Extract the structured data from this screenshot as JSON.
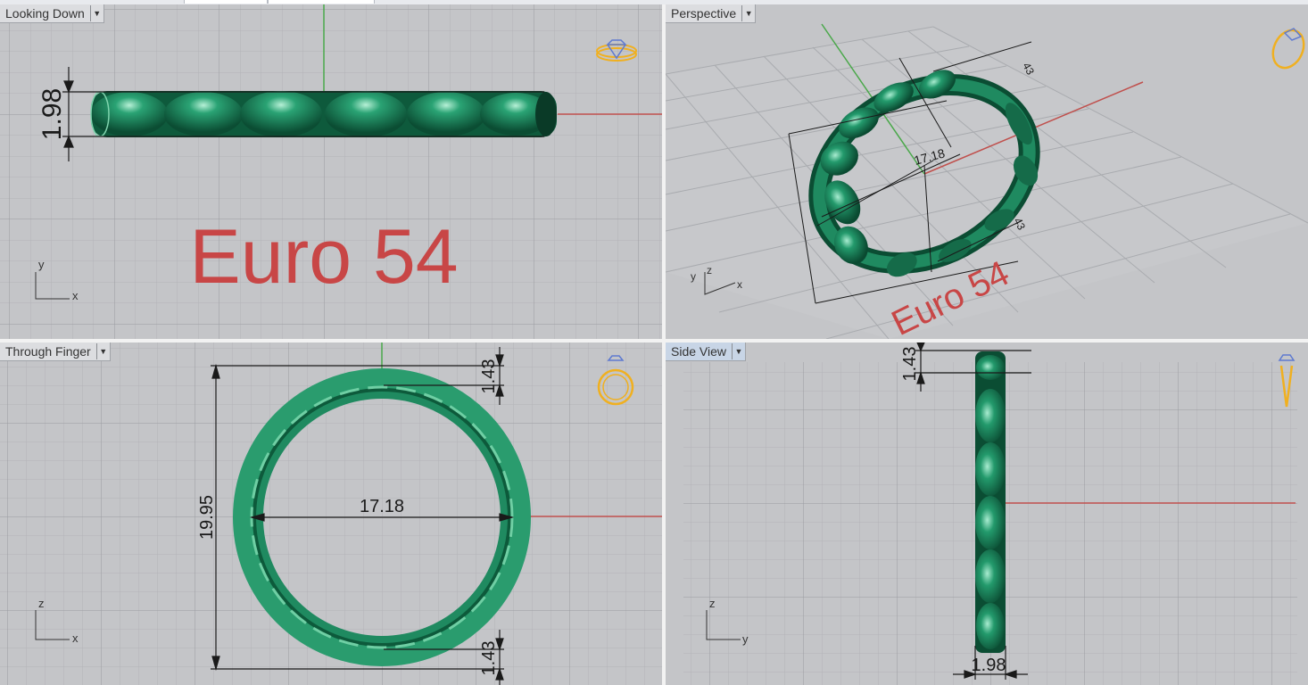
{
  "viewports": [
    {
      "id": "top",
      "label": "Looking Down",
      "active": false,
      "axes": [
        "y",
        "x"
      ],
      "annotation": "Euro 54",
      "dimensions": [
        "1.98"
      ]
    },
    {
      "id": "perspective",
      "label": "Perspective",
      "active": false,
      "axes": [
        "y",
        "z",
        "x"
      ],
      "annotation": "Euro 54",
      "dimensions": [
        "43",
        "17.18",
        "43"
      ]
    },
    {
      "id": "front",
      "label": "Through Finger",
      "active": false,
      "axes": [
        "z",
        "x"
      ],
      "dimensions": [
        "1.43",
        "17.18",
        "19.95",
        "1.43"
      ]
    },
    {
      "id": "side",
      "label": "Side View",
      "active": true,
      "axes": [
        "z",
        "y"
      ],
      "dimensions": [
        "1.43",
        "1.98"
      ]
    }
  ],
  "icons": [
    "ring-top-icon",
    "ring-perspective-icon",
    "ring-front-icon",
    "ring-side-icon"
  ],
  "colors": {
    "viewport_bg": "#c4c5c8",
    "grid_minor": "#b3b4b8",
    "grid_major": "#9a9ca1",
    "model": "#1f8a60",
    "model_dark": "#0b4d33",
    "model_light": "#8ee0bd",
    "axis_x": "#c0504d",
    "axis_y": "#4aa84a",
    "dimension": "#1a1a1a",
    "annotation": "#c84646",
    "icon": "#f0b020",
    "active_tab": "#c8d5e6"
  }
}
